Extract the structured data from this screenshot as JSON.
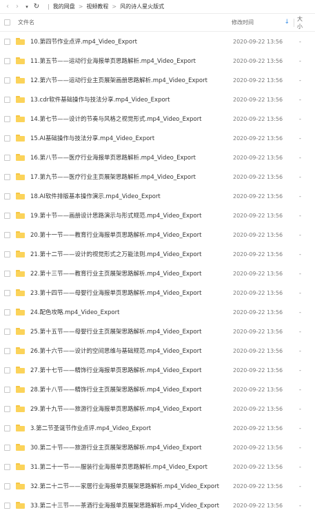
{
  "breadcrumb": [
    "我的网盘",
    "视频教程",
    "风的诗人星火版式"
  ],
  "header": {
    "name": "文件名",
    "date": "修改时间",
    "size": "大小"
  },
  "files": [
    {
      "name": "10.第四节作业点评.mp4_Video_Export",
      "date": "2020-09-22 13:56",
      "size": "-"
    },
    {
      "name": "11.第五节——运动行业海报单页思路解析.mp4_Video_Export",
      "date": "2020-09-22 13:56",
      "size": "-"
    },
    {
      "name": "12.第六节——运动行业主页展架画册思路解析.mp4_Video_Export",
      "date": "2020-09-22 13:56",
      "size": "-"
    },
    {
      "name": "13.cdr软件基础操作与技法分享.mp4_Video_Export",
      "date": "2020-09-22 13:56",
      "size": "-"
    },
    {
      "name": "14.第七节——设计的节奏与风格之视觉形式.mp4_Video_Export",
      "date": "2020-09-22 13:56",
      "size": "-"
    },
    {
      "name": "15.AI基础操作与技法分享.mp4_Video_Export",
      "date": "2020-09-22 13:56",
      "size": "-"
    },
    {
      "name": "16.第八节——医疗行业海报单页思路解析.mp4_Video_Export",
      "date": "2020-09-22 13:56",
      "size": "-"
    },
    {
      "name": "17.第九节——医疗行业主页展架思路解析.mp4_Video_Export",
      "date": "2020-09-22 13:56",
      "size": "-"
    },
    {
      "name": "18.AI软件排版基本操作演示.mp4_Video_Export",
      "date": "2020-09-22 13:56",
      "size": "-"
    },
    {
      "name": "19.第十节——画册设计思路演示与形式规范.mp4_Video_Export",
      "date": "2020-09-22 13:56",
      "size": "-"
    },
    {
      "name": "20.第十一节——教育行业海报单页思路解析.mp4_Video_Export",
      "date": "2020-09-22 13:56",
      "size": "-"
    },
    {
      "name": "21.第十二节——设计的视觉形式之万能法则.mp4_Video_Export",
      "date": "2020-09-22 13:56",
      "size": "-"
    },
    {
      "name": "22.第十三节——教育行业主页展架思路解析.mp4_Video_Export",
      "date": "2020-09-22 13:56",
      "size": "-"
    },
    {
      "name": "23.第十四节——母婴行业海报单页思路解析.mp4_Video_Export",
      "date": "2020-09-22 13:56",
      "size": "-"
    },
    {
      "name": "24.配色攻略.mp4_Video_Export",
      "date": "2020-09-22 13:56",
      "size": "-"
    },
    {
      "name": "25.第十五节——母婴行业主页展架思路解析.mp4_Video_Export",
      "date": "2020-09-22 13:56",
      "size": "-"
    },
    {
      "name": "26.第十六节——设计的空间思维与基础规范.mp4_Video_Export",
      "date": "2020-09-22 13:56",
      "size": "-"
    },
    {
      "name": "27.第十七节——精饰行业海报单页思路解析.mp4_Video_Export",
      "date": "2020-09-22 13:56",
      "size": "-"
    },
    {
      "name": "28.第十八节——精饰行业主页展架思路解析.mp4_Video_Export",
      "date": "2020-09-22 13:56",
      "size": "-"
    },
    {
      "name": "29.第十九节——旅游行业海报单页思路解析.mp4_Video_Export",
      "date": "2020-09-22 13:56",
      "size": "-"
    },
    {
      "name": "3.第二节圣诞节作业点评.mp4_Video_Export",
      "date": "2020-09-22 13:56",
      "size": "-"
    },
    {
      "name": "30.第二十节——旅游行业主页展架思路解析.mp4_Video_Export",
      "date": "2020-09-22 13:56",
      "size": "-"
    },
    {
      "name": "31.第二十一节——服装行业海报单页思路解析.mp4_Video_Export",
      "date": "2020-09-22 13:56",
      "size": "-"
    },
    {
      "name": "32.第二十二节——家居行业海报单页展架思路解析.mp4_Video_Export",
      "date": "2020-09-22 13:56",
      "size": "-"
    },
    {
      "name": "33.第二十三节——茶酒行业海报单页展架思路解析.mp4_Video_Export",
      "date": "2020-09-22 13:56",
      "size": "-"
    }
  ]
}
